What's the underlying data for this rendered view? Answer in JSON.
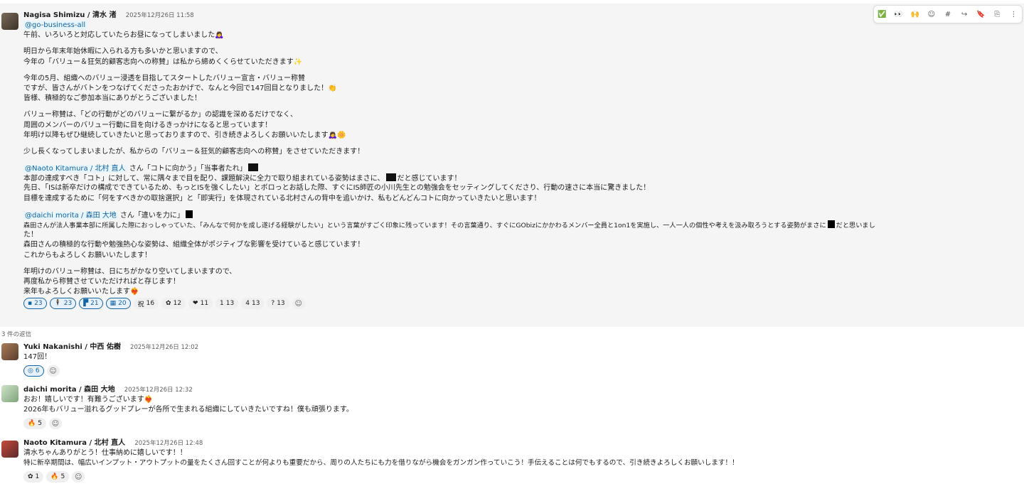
{
  "toolbar": {
    "icons": [
      "✅",
      "👀",
      "🙌",
      "☺",
      "#",
      "↪",
      "🔖",
      "⎘",
      "⋮"
    ]
  },
  "parent": {
    "author": "Nagisa Shimizu / 清水 渚",
    "time": "2025年12月26日 11:58",
    "mention_tag": "@go-business-all",
    "p1": "午前、いろいろと対応していたらお昼になってしまいました🙇‍♀️",
    "p2": [
      "明日から年末年始休暇に入られる方も多いかと思いますので、",
      "今年の「バリュー＆狂気的顧客志向への称賛」は私から締めくくらせていただきます✨"
    ],
    "p3": [
      "今年の5月、組織へのバリュー浸透を目指してスタートしたバリュー宣言・バリュー称賛",
      "ですが、皆さんがバトンをつなげてくださったおかげで、なんと今回で147回目となりました！👏",
      "皆様、積極的なご参加本当にありがとうございました！"
    ],
    "p4": [
      "バリュー称賛は、「どの行動がどのバリューに繋がるか」の認識を深めるだけでなく、",
      "周囲のメンバーのバリュー行動に目を向けるきっかけになると思っています！",
      "年明け以降もぜひ継続していきたいと思っておりますので、引き続きよろしくお願いいたします🙇‍♀️🌼"
    ],
    "p5": "少し長くなってしまいましたが、私からの「バリュー＆狂気的顧客志向への称賛」をさせていただきます！",
    "s1": {
      "mention": "@Naoto Kitamura / 北村 直人",
      "after_mention": " さん「コトに向かう」「当事者たれ」",
      "lines": [
        "本部の達成すべき「コト」に対して、常に隅々まで目を配り、課題解決に全力で取り組まれている姿勢はまさに、",
        "だと感じています！",
        "先日、「ISは新卒だけの構成でできているため、もっとISを強くしたい」とボロっとお話した際、すぐにIS師匠の小川先生との勉強会をセッティングしてくださり、行動の速さに本当に驚きました！",
        "目標を達成するために「何をすべきかの取捨選択」と「即実行」を体現されている北村さんの背中を追いかけ、私もどんどんコトに向かっていきたいと思います！"
      ]
    },
    "s2": {
      "mention": "@daichi morita / 森田 大地",
      "after_mention": " さん「違いを力に」",
      "lines": [
        "森田さんが法人事業本部に所属した際におっしゃっていた、「みんなで何かを成し遂げる経験がしたい」という言葉がすごく印象に残っています！その言葉通り、すぐにGObizにかかわるメンバー全員と1on1を実施し、一人一人の個性や考えを汲み取ろうとする姿勢がまさに",
        "だと思いまし",
        "た！",
        "森田さんの積極的な行動や勉強熱心な姿勢は、組織全体がポジティブな影響を受けていると感じています！",
        "これからもよろしくお願いいたします！"
      ]
    },
    "p_end": [
      "年明けのバリュー称賛は、日にちがかなり空いてしまいますので、",
      "再度私から称賛させていただければと存じます！",
      "来年もよろしくお願いいたします❤️‍🔥"
    ],
    "reactions": [
      {
        "icon": "▪",
        "count": "23",
        "mine": true
      },
      {
        "icon": "🕴",
        "count": "23",
        "mine": true
      },
      {
        "icon": "▛",
        "count": "21",
        "mine": true
      },
      {
        "icon": "▦",
        "count": "20",
        "mine": true
      },
      {
        "icon": "祝",
        "count": "16",
        "mine": false
      },
      {
        "icon": "✿",
        "count": "12",
        "mine": false
      },
      {
        "icon": "❤",
        "count": "11",
        "mine": false
      },
      {
        "icon": "1",
        "count": "13",
        "mine": false
      },
      {
        "icon": "4",
        "count": "13",
        "mine": false
      },
      {
        "icon": "?",
        "count": "13",
        "mine": false
      }
    ]
  },
  "replies_label": "3 件の返信",
  "replies": [
    {
      "author": "Yuki Nakanishi / 中西 佑樹",
      "time": "2025年12月26日 12:02",
      "lines": [
        "147回！"
      ],
      "reactions": [
        {
          "icon": "◎",
          "count": "6",
          "mine": true
        }
      ]
    },
    {
      "author": "daichi morita / 森田 大地",
      "time": "2025年12月26日 12:32",
      "lines": [
        "おお！嬉しいです！有難うございます❤️‍🔥",
        "2026年もバリュー溢れるグッドプレーが各所で生まれる組織にしていきたいですね！僕も頑張ります。"
      ],
      "reactions": [
        {
          "icon": "🔥",
          "count": "5",
          "mine": false
        }
      ]
    },
    {
      "author": "Naoto Kitamura / 北村 直人",
      "time": "2025年12月26日 12:48",
      "lines": [
        "清水ちゃんありがとう！仕事納めに嬉しいです！！",
        "特に新卒期間は、幅広いインプット・アウトプットの量をたくさん回すことが何よりも重要だから、周りの人たちにも力を借りながら機会をガンガン作っていこう！手伝えることは何でもするので、引き続きよろしくお願いします！！"
      ],
      "reactions": [
        {
          "icon": "✿",
          "count": "1",
          "mine": false
        },
        {
          "icon": "🔥",
          "count": "5",
          "mine": false
        }
      ]
    }
  ],
  "add_reaction_icon": "☺"
}
